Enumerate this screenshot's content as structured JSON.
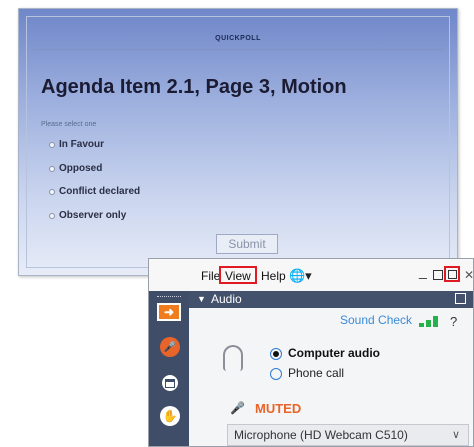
{
  "poll": {
    "title": "QUICKPOLL",
    "heading": "Agenda Item 2.1, Page 3, Motion",
    "instruction": "Please select one",
    "options": [
      "In Favour",
      "Opposed",
      "Conflict declared",
      "Observer only"
    ],
    "submit_label": "Submit"
  },
  "panel": {
    "menu": {
      "file": "File",
      "view": "View",
      "help": "Help"
    },
    "audio": {
      "header": "Audio",
      "sound_check": "Sound Check",
      "help_glyph": "?",
      "computer_audio": "Computer audio",
      "phone_call": "Phone call",
      "muted": "MUTED",
      "microphone": "Microphone (HD Webcam C510)"
    }
  },
  "icons": {
    "globe": "globe-icon",
    "minimize": "minimize-icon",
    "maximize": "maximize-icon",
    "popout": "popout-icon",
    "close": "close-icon",
    "arrow": "arrow-right-icon",
    "mic": "microphone-icon",
    "screen": "screen-icon",
    "hand": "hand-icon",
    "headset": "headset-icon",
    "signal": "signal-icon"
  },
  "colors": {
    "highlight": "#e01a22",
    "accent": "#f07c1e",
    "muted": "#e8642a",
    "link": "#3a8bd6",
    "signal": "#26b24b"
  }
}
